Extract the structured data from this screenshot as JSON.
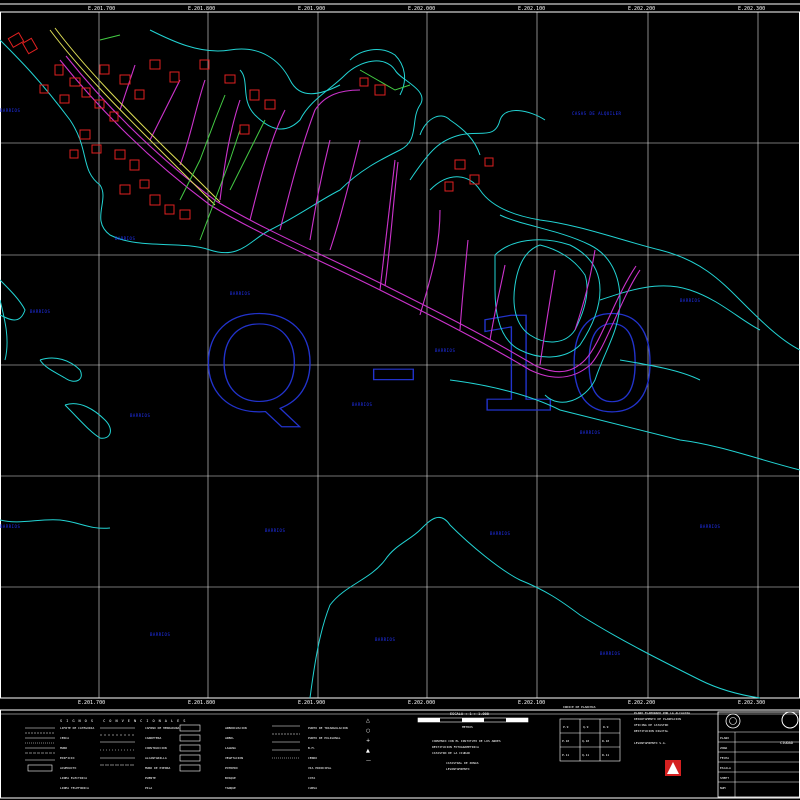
{
  "sheet": {
    "grid_label": "Q - 10",
    "top_coords": [
      "E.201.700",
      "E.201.800",
      "E.201.900",
      "E.202.000",
      "E.202.100",
      "E.202.200",
      "E.202.300"
    ],
    "bottom_coords": [
      "E.201.700",
      "E.201.800",
      "E.201.900",
      "E.202.000",
      "E.202.100",
      "E.202.200",
      "E.202.300"
    ]
  },
  "map_labels": {
    "top_right": "CASAS DE ALQUILER",
    "generic": "BARRIOS"
  },
  "legend": {
    "title": "SIGNOS CONVENCIONALES",
    "col1": [
      "LIMITE DE CATEGORIA",
      "CERCA",
      "MURO",
      "EDIFICIO",
      "ACUEDUCTO",
      "LINEA ELECTRICA",
      "LINEA TELEFONICA"
    ],
    "col2": [
      "CAMINO DE HERRADURA",
      "CARRETERA",
      "CONSTRUCCION",
      "ALCANTARILLA",
      "MURO DE PIEDRA",
      "PUENTE",
      "PILA"
    ],
    "col3": [
      "ARBORIZACION",
      "ARBOL",
      "LAGUNA",
      "VEGETACION",
      "POTRERO",
      "BOSQUE",
      "TANQUE"
    ],
    "col4": [
      "PUNTO DE TRIANGULACION",
      "PUNTO DE POLIGONAL",
      "B.M.",
      "CERRO",
      "VIA PRINCIPAL",
      "COTA",
      "CURVA"
    ]
  },
  "scale": {
    "title": "ESCALA : 1 : 1.000",
    "unit": "METROS",
    "notes": [
      "CONVENIO CON EL INSTITUTO DE LOS ANDES",
      "RESTITUCION FOTOGRAMETRICA",
      "CATASTRO DE LA CIUDAD",
      "CATASTRAL DE ZONAS",
      "LEVANTAMIENTO"
    ]
  },
  "index_grid": {
    "title": "INDICE DE PLANCHAS",
    "cells": [
      "P-9",
      "Q-9",
      "R-9",
      "P-10",
      "Q-10",
      "R-10",
      "P-11",
      "Q-11",
      "R-11"
    ]
  },
  "credits": {
    "text": [
      "PLANO ELABORADO POR LA ALCALDIA",
      "DEPARTAMENTO DE PLANEACION",
      "OFICINA DE CATASTRO",
      "RESTITUCION DIGITAL"
    ],
    "company": "LEVANTAMIENTO S.A."
  },
  "title_block": {
    "header": "CIUDAD",
    "rows": [
      "PLANO",
      "ZONA",
      "FECHA",
      "ESCALA",
      "SHEET",
      "NUM"
    ]
  }
}
